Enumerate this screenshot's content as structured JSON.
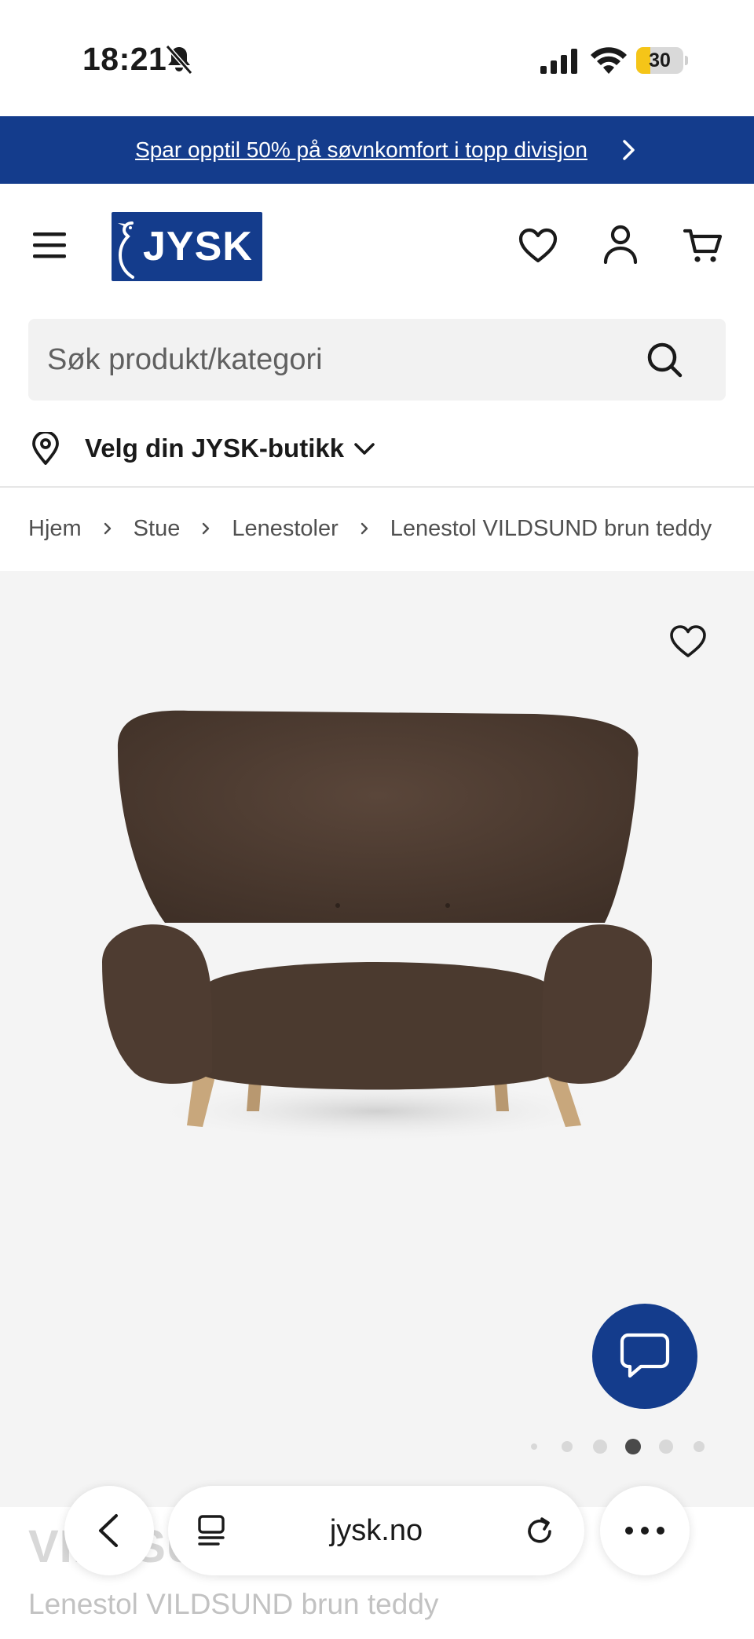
{
  "status_bar": {
    "time": "18:21",
    "battery_level": "30",
    "battery_fraction": 0.3,
    "icons": [
      "bell-muted-icon",
      "cellular-signal-icon",
      "wifi-icon",
      "battery-icon"
    ]
  },
  "promo": {
    "text": "Spar opptil 50% på søvnkomfort i topp divisjon",
    "background": "#143c8c"
  },
  "header": {
    "logo_text": "JYSK",
    "icons": [
      "menu-icon",
      "heart-icon",
      "user-icon",
      "cart-icon"
    ],
    "brand_color": "#143c8c"
  },
  "search": {
    "placeholder": "Søk produkt/kategori",
    "value": ""
  },
  "store": {
    "label": "Velg din JYSK-butikk"
  },
  "breadcrumb": {
    "items": [
      "Hjem",
      "Stue",
      "Lenestoler",
      "Lenestol VILDSUND brun teddy"
    ]
  },
  "gallery": {
    "image_alt": "Lenestol VILDSUND brun teddy",
    "dot_count": 6,
    "active_dot": 3
  },
  "product": {
    "name": "VILDSUND",
    "subtitle": "Lenestol VILDSUND brun teddy"
  },
  "browser": {
    "url": "jysk.no"
  }
}
